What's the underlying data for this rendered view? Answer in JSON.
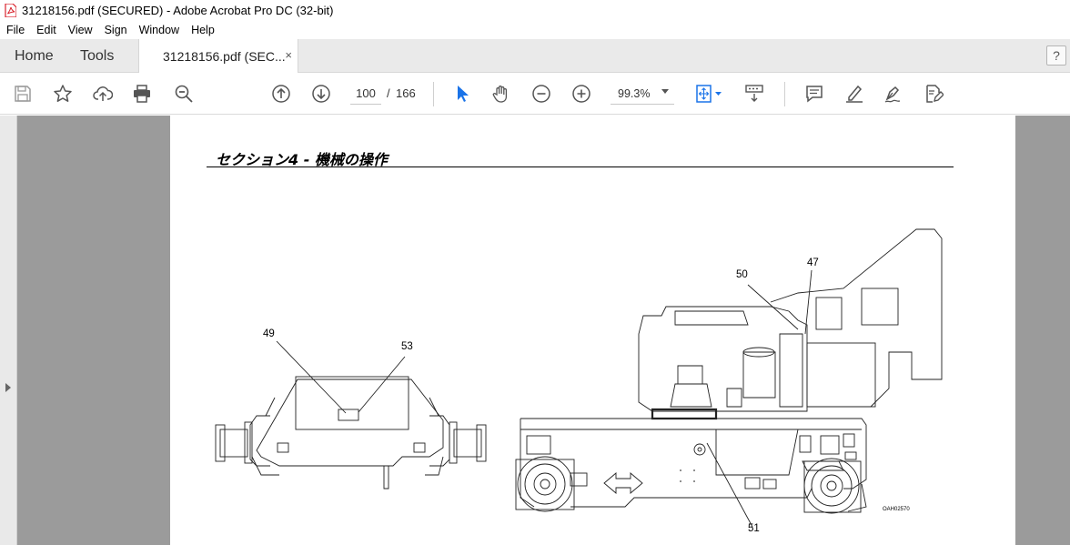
{
  "window": {
    "title": "31218156.pdf (SECURED) - Adobe Acrobat Pro DC (32-bit)"
  },
  "menu": {
    "items": [
      "File",
      "Edit",
      "View",
      "Sign",
      "Window",
      "Help"
    ]
  },
  "tabs": {
    "home": "Home",
    "tools": "Tools",
    "document": "31218156.pdf (SEC...",
    "close": "×"
  },
  "toolbar": {
    "page_current": "100",
    "page_separator": "/",
    "page_total": "166",
    "zoom": "99.3%",
    "help": "?"
  },
  "document": {
    "heading": "セクション4 - 機械の操作",
    "callouts": {
      "c49": "49",
      "c53": "53",
      "c50": "50",
      "c47": "47",
      "c51": "51",
      "figure_id": "OAH02570"
    }
  },
  "colors": {
    "accent_blue": "#1a73e8",
    "pdf_red": "#d9232d",
    "workspace_gray": "#9b9b9b"
  }
}
